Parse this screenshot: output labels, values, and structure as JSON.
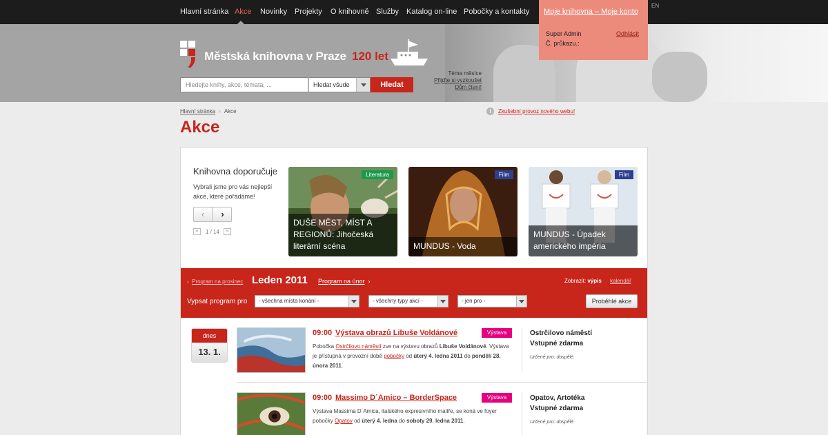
{
  "nav": {
    "items": [
      "Hlavní stránka",
      "Akce",
      "Novinky",
      "Projekty",
      "O knihovně",
      "Služby",
      "Katalog on-line",
      "Pobočky a kontakty"
    ],
    "lang": "EN"
  },
  "header": {
    "logo_text": "Městská knihovna v Praze",
    "logo_years": "120 let",
    "search_placeholder": "Hledejte knihy, akce, témata, ...",
    "search_scope": "Hledat všude",
    "search_button": "Hledat",
    "theme_label": "Téma měsíce",
    "theme_link1": "Přijďte si vyzkoušet",
    "theme_link2": "Dům čtení!"
  },
  "user": {
    "heading": "Moje knihovna – Moje konto",
    "name": "Super Admin",
    "logout": "Odhlásit",
    "card": "Č. průkazu.:"
  },
  "breadcrumb": {
    "home": "Hlavní stránka",
    "current": "Akce"
  },
  "notice": "Zkušební provoz nového webu!",
  "page_title": "Akce",
  "recommend": {
    "title": "Knihovna doporučuje",
    "desc": "Vybrali jsme pro vás nejlepší akce, které pořádáme!",
    "page_info": "1 / 14",
    "cards": [
      {
        "category": "Literatura",
        "caption": "DUŠE MĚST, MÍST A REGIONŮ: Jihočeská literární scéna",
        "cat_color": "#1c9a4c"
      },
      {
        "category": "Film",
        "caption": "MUNDUS - Voda",
        "cat_color": "#2e3f8e"
      },
      {
        "category": "Film",
        "caption": "MUNDUS - Úpadek amerického impéria",
        "cat_color": "#2e3f8e"
      }
    ]
  },
  "program": {
    "prev_month": "Program na prosinec",
    "month": "Leden 2011",
    "next_month": "Program na únor",
    "view_label": "Zobrazit:",
    "view_list": "výpis",
    "view_calendar": "kalendář",
    "filter_label": "Vypsat program pro",
    "filters": [
      "- všechna místa konání -",
      "- všechny typy akcí -",
      "- jen pro -"
    ],
    "past_button": "Proběhlé akce"
  },
  "today": {
    "label": "dnes",
    "date": "13. 1."
  },
  "events": [
    {
      "time": "09:00",
      "title": "Výstava obrazů Libuše Voldánové",
      "badge": "Výstava",
      "d1": "Pobočka",
      "d2": "Ostrčilovo náměstí",
      "d3": "zve na výstavu obrazů",
      "d4": "Libuše Voldánové",
      "d5": ". Výstava je přístupná v provozní době",
      "d6": "pobočky",
      "d7": "od",
      "d8": "úterý 4. ledna 2011",
      "d9": "do",
      "d10": "pondělí 28. února 2011",
      "d11": ".",
      "place": "Ostrčilovo náměstí",
      "price": "Vstupné zdarma",
      "for": "Určené pro: dospělé."
    },
    {
      "time": "09:00",
      "title": "Massimo D´Amico – BorderSpace",
      "badge": "Výstava",
      "d1": "Výstava Massima D´Amica, italského expresivního malíře, se koná ve foyer pobočky",
      "d2": "Opatov",
      "d3": "od",
      "d4": "úterý 4. ledna",
      "d5": "do",
      "d6": "soboty 29. ledna 2011",
      "d7": ".",
      "place": "Opatov, Artotéka",
      "price": "Vstupné zdarma",
      "for": "Určené pro: dospělé."
    }
  ]
}
